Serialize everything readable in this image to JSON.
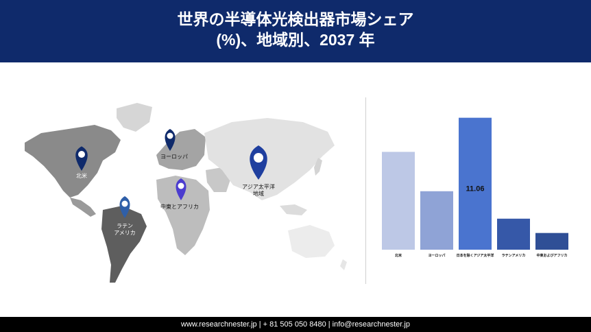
{
  "header": {
    "title_line1": "世界の半導体光検出器市場シェア",
    "title_line2": "(%)、地域別、2037 年"
  },
  "map": {
    "regions": [
      {
        "label_lines": [
          "北米"
        ],
        "pin_color": "#0f2a6b"
      },
      {
        "label_lines": [
          "ヨーロッパ"
        ],
        "pin_color": "#0f2a6b"
      },
      {
        "label_lines": [
          "アジア太平洋",
          "地域"
        ],
        "pin_color": "#1f3f9f"
      },
      {
        "label_lines": [
          "中東とアフリカ"
        ],
        "pin_color": "#4b3ccf"
      },
      {
        "label_lines": [
          "ラテン",
          "アメリカ"
        ],
        "pin_color": "#2f5fa8"
      }
    ]
  },
  "chart_data": {
    "type": "bar",
    "categories": [
      "北米",
      "ヨーロッパ",
      "日本を除くアジア太平洋",
      "ラテンアメリカ",
      "中東およびアフリカ"
    ],
    "values": [
      8.2,
      4.9,
      11.06,
      2.6,
      1.4
    ],
    "colors": [
      "#bdc8e6",
      "#8fa3d6",
      "#4a74cf",
      "#3658a8",
      "#2f4f96"
    ],
    "data_labels": [
      "",
      "",
      "11.06",
      "",
      ""
    ],
    "ylim": [
      0,
      11.5
    ],
    "grid": false
  },
  "footer": {
    "text": "www.researchnester.jp | + 81 505 050 8480 | info@researchnester.jp"
  }
}
